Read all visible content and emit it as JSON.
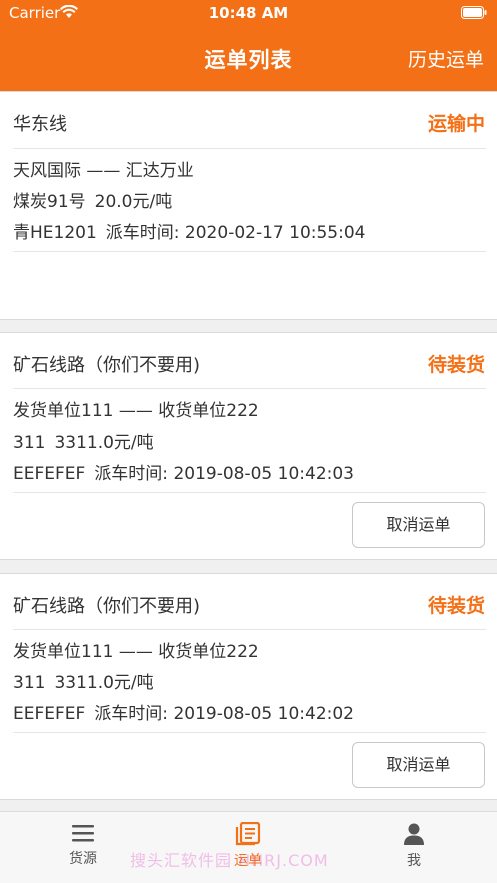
{
  "status_bar": {
    "carrier": "Carrier",
    "time": "10:48 AM"
  },
  "nav": {
    "title": "运单列表",
    "right_action": "历史运单"
  },
  "orders": [
    {
      "route": "华东线",
      "status": "运输中",
      "parties": "天风国际 —— 汇达万业",
      "cargo": "煤炭91号",
      "price": "20.0元/吨",
      "plate": "青HE1201",
      "dispatch": "派车时间: 2020-02-17 10:55:04"
    },
    {
      "route": "矿石线路（你们不要用)",
      "status": "待装货",
      "parties": "发货单位111 —— 收货单位222",
      "cargo": "311",
      "price": "3311.0元/吨",
      "plate": "EEFEFEF",
      "dispatch": "派车时间: 2019-08-05 10:42:03",
      "action": "取消运单"
    },
    {
      "route": "矿石线路（你们不要用)",
      "status": "待装货",
      "parties": "发货单位111 —— 收货单位222",
      "cargo": "311",
      "price": "3311.0元/吨",
      "plate": "EEFEFEF",
      "dispatch": "派车时间: 2019-08-05 10:42:02",
      "action": "取消运单"
    }
  ],
  "tabbar": {
    "tabs": [
      {
        "label": "货源",
        "icon": "menu-icon",
        "active": false
      },
      {
        "label": "运单",
        "icon": "document-icon",
        "active": true
      },
      {
        "label": "我",
        "icon": "person-icon",
        "active": false
      }
    ],
    "watermark": "搜头汇软件园 HHRJ.COM"
  },
  "colors": {
    "accent": "#f37016",
    "background": "#f0f0f0"
  }
}
